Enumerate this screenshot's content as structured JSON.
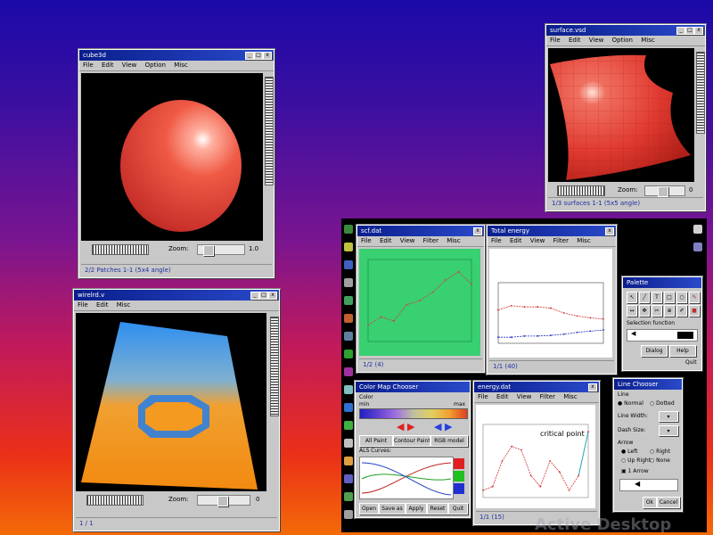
{
  "windows": {
    "cube3d": {
      "title": "cube3d",
      "menu": [
        "File",
        "Edit",
        "View",
        "Option",
        "Misc"
      ],
      "zoom_label": "Zoom:",
      "zoom_value": "1.0",
      "status": "2/2 Patches 1-1 (5x4 angle)"
    },
    "wirelrd": {
      "title": "wirelrd.v",
      "menu": [
        "File",
        "Edit",
        "Misc"
      ],
      "zoom_label": "Zoom:",
      "zoom_value": "0",
      "status": "1 / 1"
    },
    "surface": {
      "title": "surface.vsd",
      "menu": [
        "File",
        "Edit",
        "View",
        "Option",
        "Misc"
      ],
      "zoom_label": "Zoom:",
      "zoom_value": "0",
      "status": "1/3 surfaces 1-1 (5x5 angle)"
    },
    "green": {
      "title": "scf.dat",
      "menu": [
        "File",
        "Edit",
        "View",
        "Filter",
        "Misc"
      ],
      "status": "1/2 (4)"
    },
    "white_plot": {
      "title": "Total energy",
      "menu": [
        "File",
        "Edit",
        "View",
        "Filter",
        "Misc"
      ],
      "status": "1/1 (40)"
    },
    "colormap": {
      "title": "Color Map Chooser",
      "section": "Color",
      "min": "min",
      "max": "max",
      "tabs": [
        "All Paint",
        "Contour Paint",
        "RGB model"
      ],
      "sub": "ALS Curves:",
      "buttons": [
        "Open",
        "Save as",
        "Apply",
        "Reset",
        "Quit"
      ]
    },
    "critical": {
      "title": "energy.dat",
      "menu": [
        "File",
        "Edit",
        "View",
        "Filter",
        "Misc"
      ],
      "annotation": "critical point",
      "status": "1/1 (15)"
    },
    "palette": {
      "title": "Palette",
      "text": "Selection function",
      "buttons": [
        "Dialog",
        "Help"
      ],
      "quit": "Quit"
    },
    "linechooser": {
      "title": "Line Chooser",
      "sec1": "Line",
      "options": [
        "Normal",
        "Dotted"
      ],
      "width_label": "Line Width:",
      "dash_label": "Dash Size:",
      "arrow_label": "Arrow",
      "arrow_options": [
        "Left",
        "Right",
        "Up Right",
        "None"
      ],
      "arrow_sel": "1 Arrow",
      "buttons": [
        "Ok",
        "Cancel"
      ]
    }
  },
  "desktop": {
    "watermark": "Active Desktop"
  },
  "colors": {
    "sphere": "#e04030",
    "green_panel": "#38d070",
    "title_blue": "#0a1e8c"
  },
  "chart_data": [
    {
      "type": "line",
      "series": [
        {
          "values": [
            0.2,
            0.3,
            0.25,
            0.45,
            0.5,
            0.6,
            0.75,
            0.85,
            0.7
          ]
        }
      ]
    },
    {
      "type": "line",
      "series": [
        {
          "values": [
            0.55,
            0.62,
            0.6,
            0.6,
            0.58,
            0.5,
            0.45,
            0.42,
            0.4
          ]
        },
        {
          "values": [
            0.1,
            0.1,
            0.12,
            0.12,
            0.13,
            0.15,
            0.18,
            0.2,
            0.22
          ]
        }
      ]
    },
    {
      "type": "line",
      "series": [
        {
          "values": [
            0.1,
            0.15,
            0.5,
            0.7,
            0.65,
            0.3,
            0.15,
            0.5,
            0.35,
            0.1,
            0.3,
            0.9
          ]
        }
      ]
    }
  ]
}
